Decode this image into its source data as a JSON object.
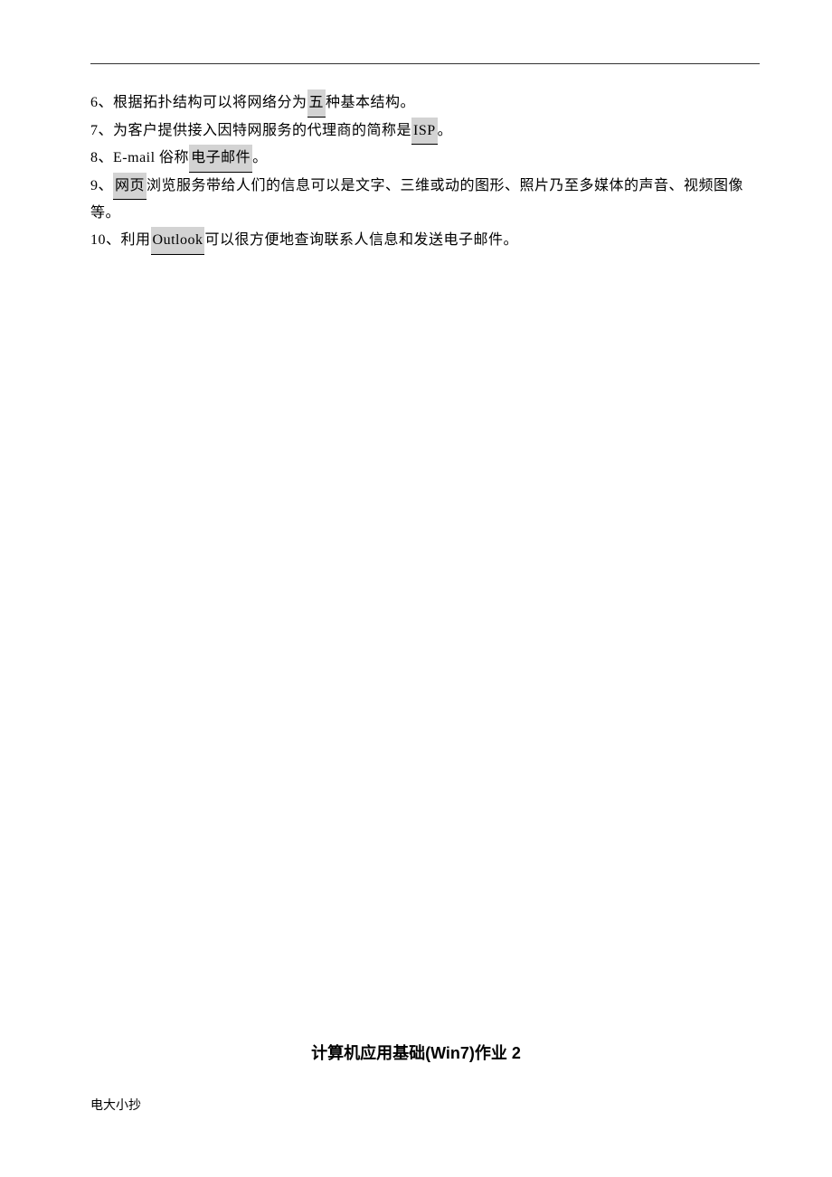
{
  "lines": [
    {
      "num": "6、",
      "pre": "根据拓扑结构可以将网络分为",
      "blank": " 五 ",
      "post": "种基本结构。"
    },
    {
      "num": "7、",
      "pre": "为客户提供接入因特网服务的代理商的简称是",
      "blank": " ISP ",
      "post": "。"
    },
    {
      "num": "8、",
      "pre": "E-mail 俗称",
      "blank": " 电子邮件 ",
      "post": "。"
    },
    {
      "num": "9、",
      "pre": "",
      "blank": " 网页 ",
      "post": "浏览服务带给人们的信息可以是文字、三维或动的图形、照片乃至多媒体的声音、视频图像等。"
    },
    {
      "num": "10、",
      "pre": "利用",
      "blank": " Outlook ",
      "post": "可以很方便地查询联系人信息和发送电子邮件。"
    }
  ],
  "heading": "计算机应用基础(Win7)作业 2",
  "footer": "电大小抄"
}
